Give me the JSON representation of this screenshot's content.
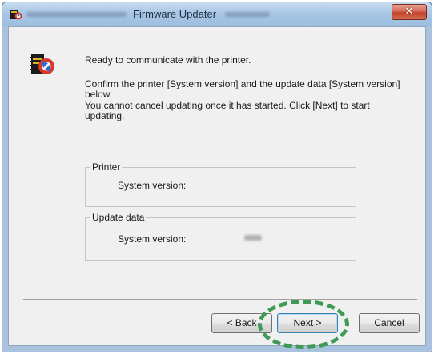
{
  "window": {
    "title": "Firmware Updater",
    "close_label": "✕"
  },
  "message": {
    "line1": "Ready to communicate with the printer.",
    "line2": "Confirm the printer [System version] and the update data [System version] below.",
    "line3": "You cannot cancel updating once it has started. Click [Next] to start updating."
  },
  "groups": {
    "printer": {
      "title": "Printer",
      "field_label": "System version:",
      "field_value": ""
    },
    "update_data": {
      "title": "Update data",
      "field_label": "System version:",
      "field_value": ""
    }
  },
  "buttons": {
    "back_label": "< Back",
    "next_label": "Next >",
    "cancel_label": "Cancel"
  },
  "colors": {
    "highlight": "#3e9a55",
    "close_button": "#c1432b"
  }
}
